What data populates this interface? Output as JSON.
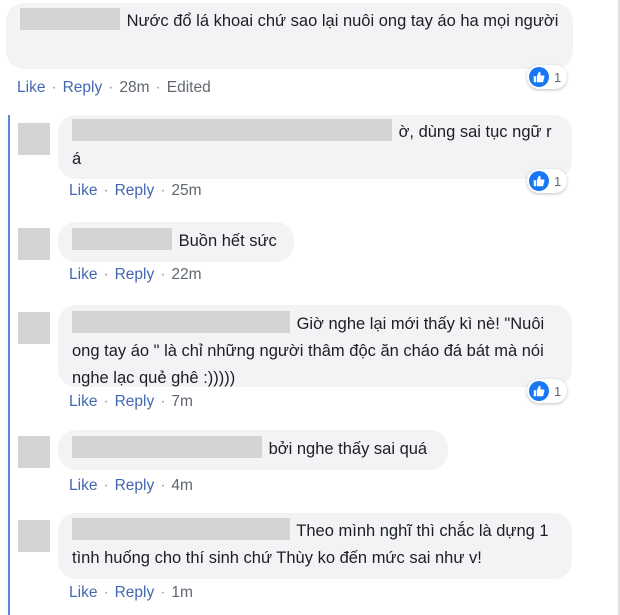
{
  "comments": [
    {
      "text": "Nước đổ lá khoai chứ sao lại nuôi ong tay áo ha mọi người",
      "actions": {
        "like": "Like",
        "reply": "Reply",
        "time": "28m",
        "edited": "Edited"
      },
      "reactions": "1"
    },
    {
      "text": "ờ, dùng sai tục ngữ r á",
      "actions": {
        "like": "Like",
        "reply": "Reply",
        "time": "25m"
      },
      "reactions": "1"
    },
    {
      "text": "Buồn hết sức",
      "actions": {
        "like": "Like",
        "reply": "Reply",
        "time": "22m"
      }
    },
    {
      "text": "Giờ nghe lại mới thấy kì nè! \"Nuôi ong tay áo \" là chỉ những người thâm độc ăn cháo đá bát mà nói nghe lạc quẻ ghê :)))))",
      "actions": {
        "like": "Like",
        "reply": "Reply",
        "time": "7m"
      },
      "reactions": "1"
    },
    {
      "text": "bởi nghe thấy sai quá",
      "actions": {
        "like": "Like",
        "reply": "Reply",
        "time": "4m"
      }
    },
    {
      "text": "Theo mình nghĩ thì chắc là dựng 1 tình huống cho thí sinh chứ Thùy ko đến mức sai như v!",
      "actions": {
        "like": "Like",
        "reply": "Reply",
        "time": "1m"
      }
    }
  ],
  "colors": {
    "link": "#4267b2",
    "bubble": "#f2f3f5",
    "like": "#1877f2",
    "thread_line": "#5a86d6"
  },
  "icons": {
    "reaction": "thumbs-up-icon"
  }
}
